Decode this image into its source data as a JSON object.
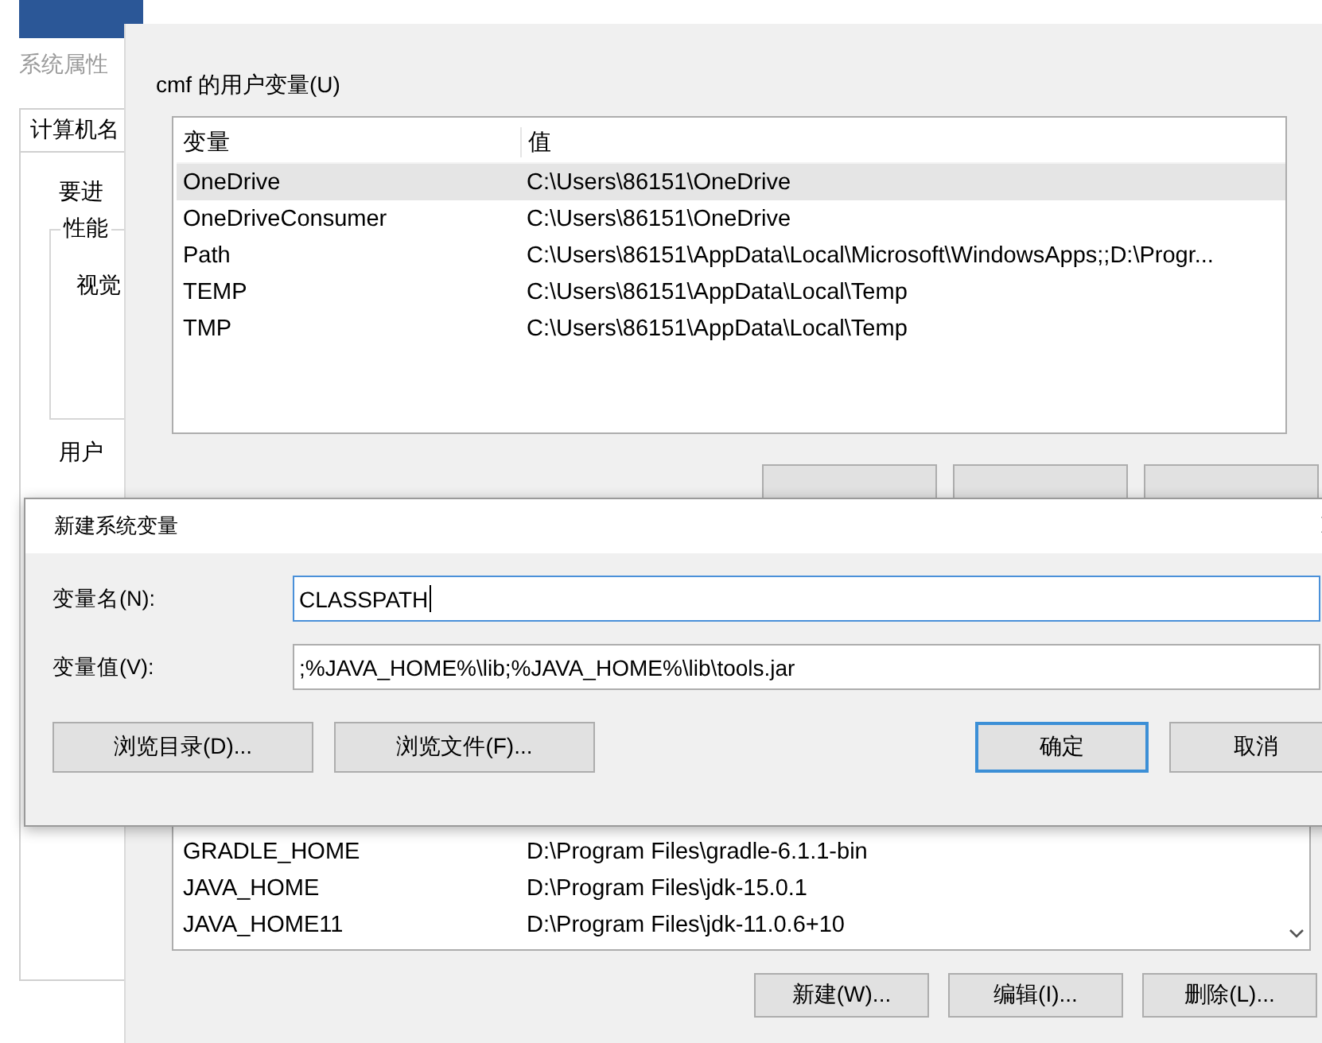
{
  "back_window": {
    "title": "系统属性",
    "tab": "计算机名",
    "texts": [
      "要进",
      "性能",
      "视觉",
      "用户"
    ]
  },
  "env_window": {
    "user_group": "cmf 的用户变量(U)",
    "user_table": {
      "columns": [
        "变量",
        "值"
      ],
      "rows": [
        {
          "name": "OneDrive",
          "value": "C:\\Users\\86151\\OneDrive",
          "selected": true
        },
        {
          "name": "OneDriveConsumer",
          "value": "C:\\Users\\86151\\OneDrive",
          "selected": false
        },
        {
          "name": "Path",
          "value": "C:\\Users\\86151\\AppData\\Local\\Microsoft\\WindowsApps;;D:\\Progr...",
          "selected": false
        },
        {
          "name": "TEMP",
          "value": "C:\\Users\\86151\\AppData\\Local\\Temp",
          "selected": false
        },
        {
          "name": "TMP",
          "value": "C:\\Users\\86151\\AppData\\Local\\Temp",
          "selected": false
        }
      ]
    },
    "system_table": {
      "rows": [
        {
          "name": "GRADLE_HOME",
          "value": "D:\\Program Files\\gradle-6.1.1-bin",
          "selected": false
        },
        {
          "name": "JAVA_HOME",
          "value": "D:\\Program Files\\jdk-15.0.1",
          "selected": false
        },
        {
          "name": "JAVA_HOME11",
          "value": "D:\\Program Files\\jdk-11.0.6+10",
          "selected": false
        }
      ]
    },
    "system_buttons": [
      "新建(W)...",
      "编辑(I)...",
      "删除(L)..."
    ]
  },
  "dialog": {
    "title": "新建系统变量",
    "fields": [
      {
        "label": "变量名(N):",
        "value": "CLASSPATH",
        "focused": true
      },
      {
        "label": "变量值(V):",
        "value": ";%JAVA_HOME%\\lib;%JAVA_HOME%\\lib\\tools.jar",
        "focused": false
      }
    ],
    "left_buttons": [
      "浏览目录(D)...",
      "浏览文件(F)..."
    ],
    "right_buttons": [
      {
        "label": "确定",
        "default": true
      },
      {
        "label": "取消",
        "default": false
      }
    ]
  }
}
